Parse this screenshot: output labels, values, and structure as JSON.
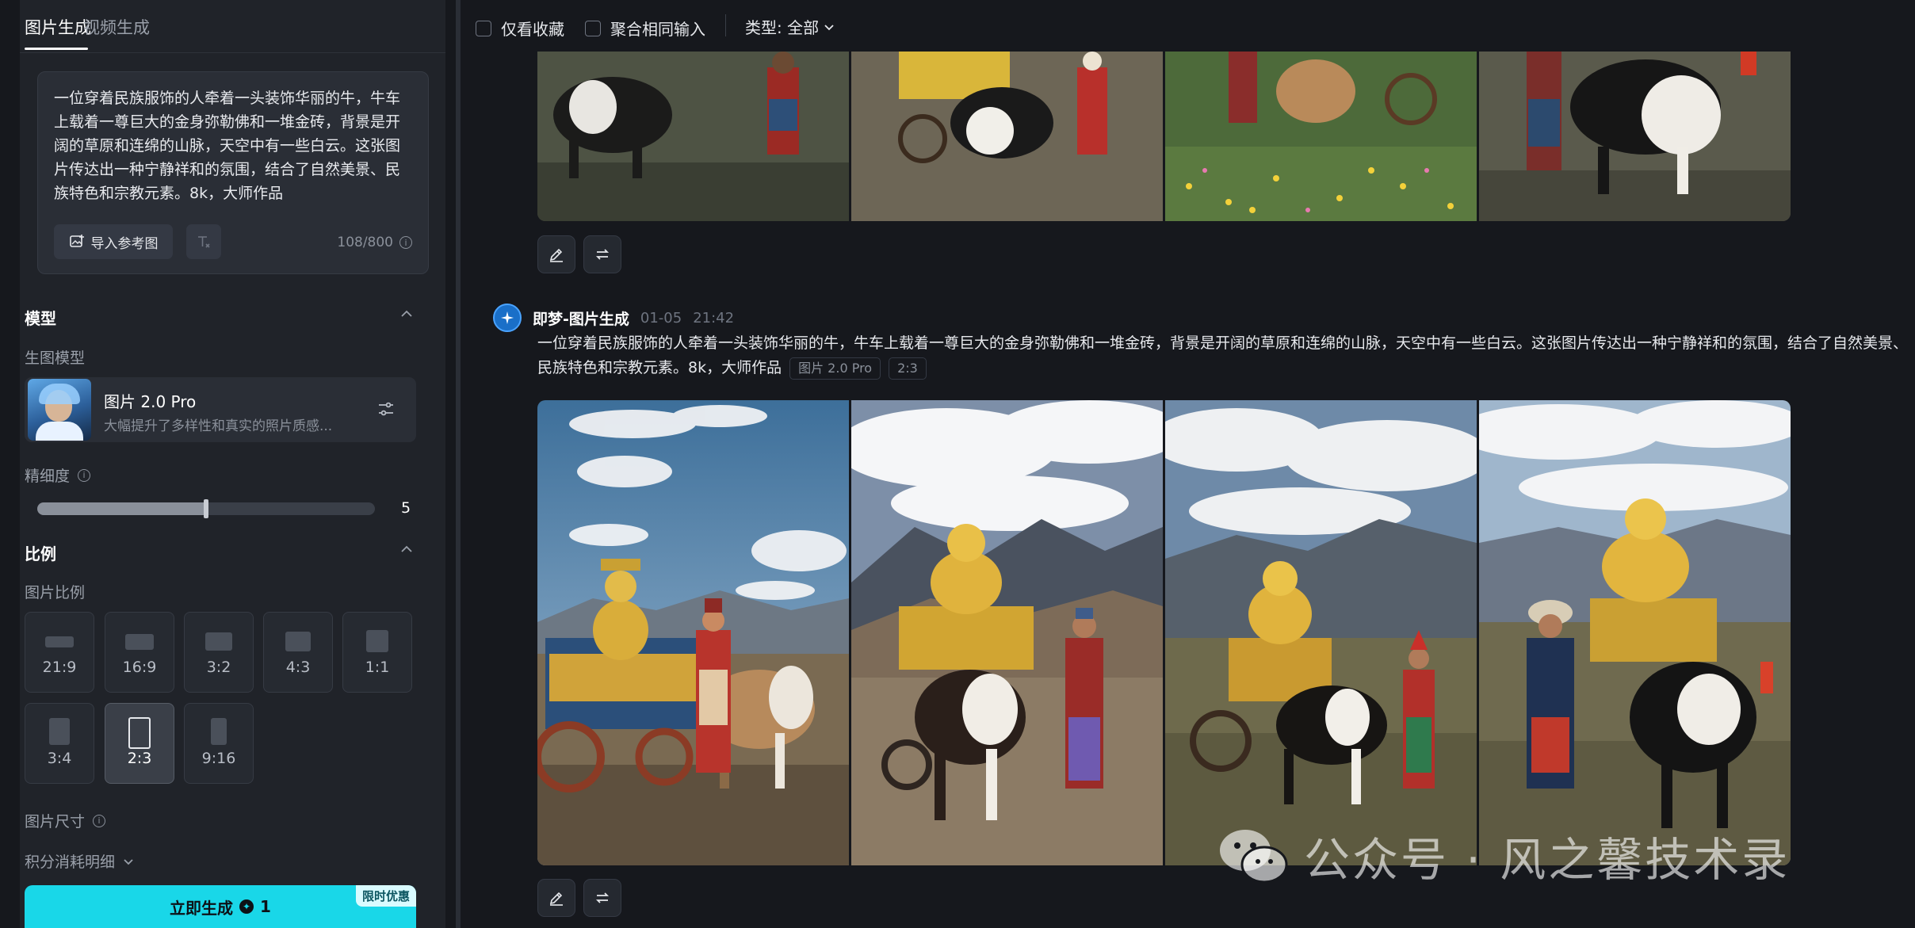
{
  "left_panel": {
    "tabs": [
      "图片生成",
      "视频生成"
    ],
    "prompt": {
      "text": "一位穿着民族服饰的人牵着一头装饰华丽的牛，牛车上载着一尊巨大的金身弥勒佛和一堆金砖，背景是开阔的草原和连绵的山脉，天空中有一些白云。这张图片传达出一种宁静祥和的氛围，结合了自然美景、民族特色和宗教元素。8k，大师作品",
      "import_ref_label": "导入参考图",
      "counter": "108/800"
    },
    "model_section": {
      "title": "模型",
      "sub_label": "生图模型",
      "model_name": "图片 2.0 Pro",
      "model_desc": "大幅提升了多样性和真实的照片质感..."
    },
    "detail": {
      "label": "精细度",
      "value": 5,
      "value_text": "5",
      "max": 10
    },
    "ratio_section": {
      "title": "比例",
      "sub_label": "图片比例",
      "ratios": [
        "21:9",
        "16:9",
        "3:2",
        "4:3",
        "1:1",
        "3:4",
        "2:3",
        "9:16"
      ],
      "selected": "2:3"
    },
    "size_label": "图片尺寸",
    "credit_label": "积分消耗明细",
    "generate": {
      "label": "立即生成",
      "cost": "1",
      "promo": "限时优惠"
    }
  },
  "main": {
    "toolbar": {
      "fav_only": "仅看收藏",
      "merge_same": "聚合相同输入",
      "type_filter": "类型: 全部"
    },
    "generation": {
      "name": "即梦-图片生成",
      "date": "01-05",
      "time": "21:42",
      "prompt": "一位穿着民族服饰的人牵着一头装饰华丽的牛，牛车上载着一尊巨大的金身弥勒佛和一堆金砖，背景是开阔的草原和连绵的山脉，天空中有一些白云。这张图片传达出一种宁静祥和的氛围，结合了自然美景、民族特色和宗教元素。8k，大师作品",
      "model_tag": "图片 2.0 Pro",
      "ratio_tag": "2:3"
    },
    "watermark": "公众号 · 风之馨技术录"
  },
  "colors": {
    "accent": "#19d7e8",
    "panel_bg": "#202329",
    "page_bg": "#16181d"
  }
}
